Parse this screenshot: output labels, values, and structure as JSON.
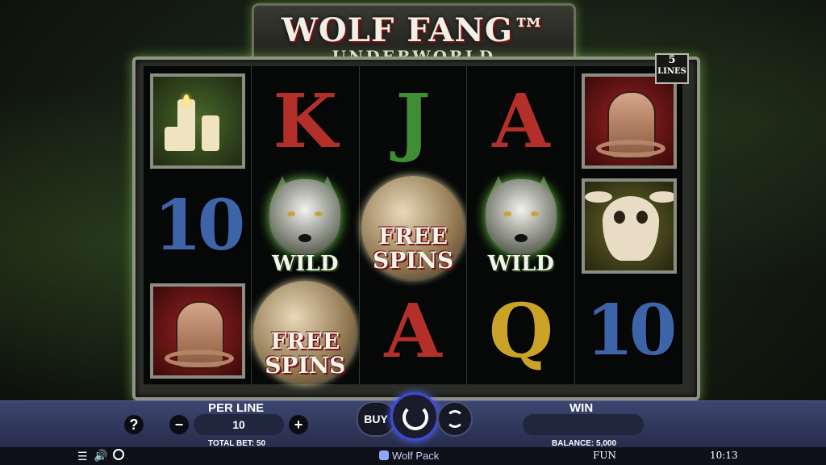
{
  "logo": {
    "title": "WOLF FANG™",
    "subtitle": "UNDERWORLD"
  },
  "lines_badge": {
    "count": "5",
    "label": "LINES"
  },
  "reels": [
    [
      {
        "symbol": "candles"
      },
      {
        "symbol": "10"
      },
      {
        "symbol": "cobra"
      }
    ],
    [
      {
        "symbol": "K"
      },
      {
        "symbol": "wolf",
        "label": "WILD"
      },
      {
        "symbol": "moon",
        "label_1": "FREE",
        "label_2": "SPINS"
      }
    ],
    [
      {
        "symbol": "J"
      },
      {
        "symbol": "moon",
        "label_1": "FREE",
        "label_2": "SPINS"
      },
      {
        "symbol": "A"
      }
    ],
    [
      {
        "symbol": "A"
      },
      {
        "symbol": "wolf",
        "label": "WILD"
      },
      {
        "symbol": "Q"
      }
    ],
    [
      {
        "symbol": "cobra"
      },
      {
        "symbol": "bull-skull"
      },
      {
        "symbol": "10"
      }
    ]
  ],
  "controls": {
    "help": "?",
    "per_line_label": "PER LINE",
    "minus": "−",
    "per_line_value": "10",
    "plus": "+",
    "total_bet": "TOTAL BET: 50",
    "buy": "BUY",
    "win_label": "WIN",
    "win_value": "",
    "balance": "BALANCE: 5,000"
  },
  "status": {
    "brand": "Wolf Pack",
    "mode": "FUN",
    "time": "10:13"
  },
  "icons": [
    "menu-icon",
    "sound-icon",
    "turbo-icon",
    "spin-icon",
    "autoplay-icon",
    "wolf-pack-logo-icon"
  ],
  "colors": {
    "panel": "#2f365a",
    "spin_ring": "#3d4bd1",
    "frame_glow": "#96dc5a"
  }
}
